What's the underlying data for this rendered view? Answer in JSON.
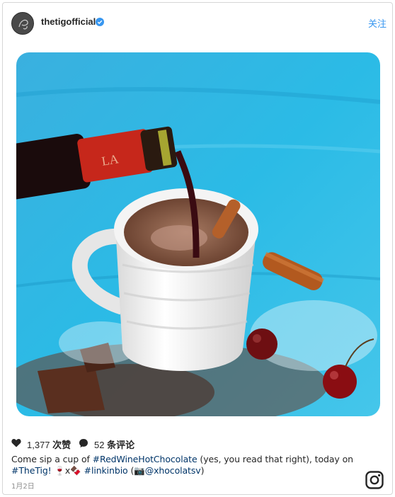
{
  "header": {
    "username": "thetigofficial",
    "follow_label": "关注",
    "verified_icon": "verified-badge-icon"
  },
  "post": {
    "likes_number": "1,377",
    "likes_word": "次赞",
    "comments_number": "52",
    "comments_word": "条评论",
    "caption": {
      "line1_before": "Come sip a cup of ",
      "line1_tag": "#RedWineHotChocolate",
      "line1_after": " (yes, you read that right), today on",
      "line2_tag1": "#TheTig!",
      "line2_emoji": " 🍷x🍫 ",
      "line2_tag2": "#linkinbio",
      "line2_open": " (📷",
      "line2_mention": "@xhocolatsv",
      "line2_close": ")"
    },
    "date": "1月2日"
  },
  "colors": {
    "link_blue": "#3897f0",
    "hashtag_blue": "#003569",
    "background_teal": "#2fb7e0"
  }
}
